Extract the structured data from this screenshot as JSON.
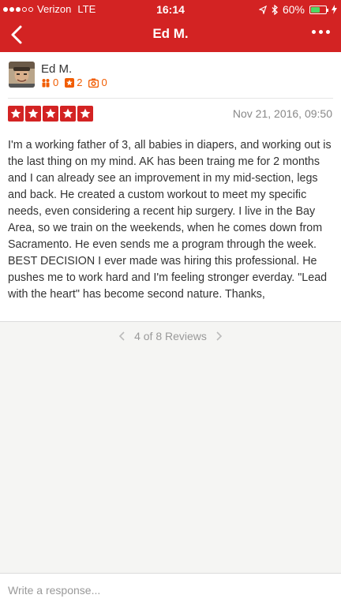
{
  "status_bar": {
    "carrier": "Verizon",
    "network": "LTE",
    "time": "16:14",
    "battery": "60%",
    "battery_level": 0.6
  },
  "nav": {
    "title": "Ed M."
  },
  "review": {
    "user_name": "Ed M.",
    "friends_count": "0",
    "reviews_count": "2",
    "photos_count": "0",
    "rating": 5,
    "date": "Nov 21, 2016, 09:50",
    "text": "I'm a working father of 3, all babies in diapers, and working out is the last thing on my mind. AK has been traing me for 2 months and I can already see an improvement in my mid-section, legs and back. He created a custom workout to meet my specific needs, even considering a recent hip surgery. I live in the Bay Area, so we train on the weekends, when he comes down from Sacramento. He even sends me a program through the week. BEST DECISION I ever made was hiring this professional. He pushes me to work hard and I'm feeling stronger everday. \"Lead with the heart\" has become second nature. Thanks,"
  },
  "pager": {
    "label": "4 of 8 Reviews"
  },
  "response": {
    "placeholder": "Write a response..."
  },
  "colors": {
    "brand": "#d32323",
    "stat_orange": "#f15c00"
  }
}
